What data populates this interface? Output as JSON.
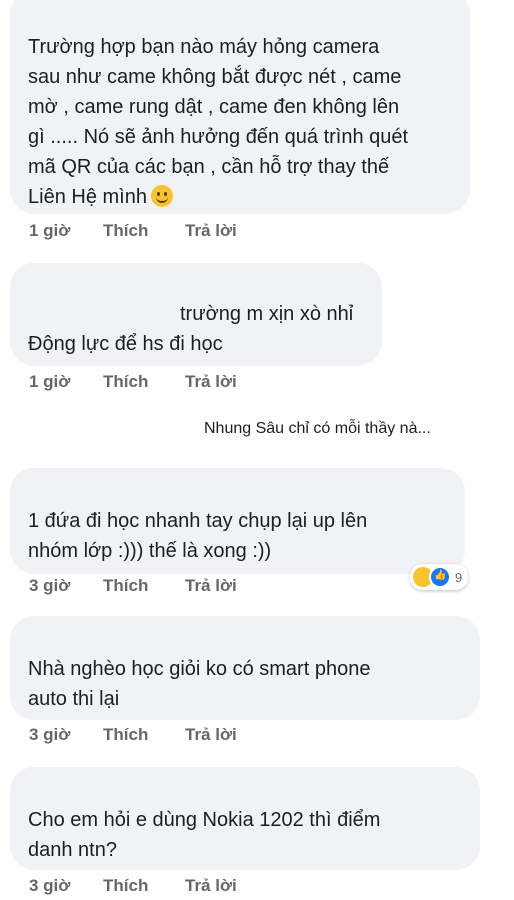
{
  "actions": {
    "like": "Thích",
    "reply": "Trả lời"
  },
  "comments": [
    {
      "lines": [
        "Trường hợp bạn nào máy hỏng camera",
        "sau như came không bắt được nét ,  came",
        "mờ , came rung dật , came đen không lên",
        "gì ..... Nó sẽ ảnh hưởng đến quá trình quét",
        "mã QR của các bạn , cần hỗ trợ thay thế",
        "Liên Hệ mình"
      ],
      "emoji": "smile-emoji",
      "time": "1 giờ"
    },
    {
      "lines": [
        "trường m xịn xò nhỉ",
        "Động lực để hs đi học"
      ],
      "time": "1 giờ"
    },
    {
      "lines": [
        "1 đứa đi học nhanh tay chụp lại up lên",
        "nhóm lớp :))) thế là xong :))"
      ],
      "time": "3 giờ",
      "reactions": {
        "icons": [
          "haha-icon",
          "like-icon"
        ],
        "count": "9"
      }
    },
    {
      "lines": [
        "Nhà nghèo học giỏi ko có smart phone",
        "auto thi lại"
      ],
      "time": "3 giờ"
    },
    {
      "lines": [
        "Cho em hỏi e dùng Nokia 1202 thì điểm",
        "danh ntn?"
      ],
      "time": "3 giờ"
    }
  ],
  "reply_ref": "Nhung Sâu chỉ có mỗi thầy nà..."
}
